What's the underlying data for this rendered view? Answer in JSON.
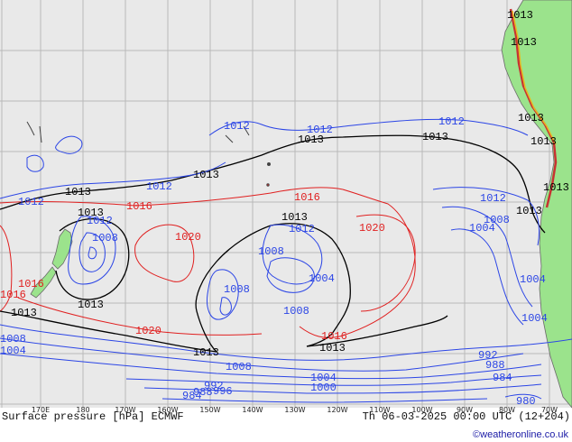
{
  "colors": {
    "ocean": "#e9e9e9",
    "land": "#9be38c",
    "grid": "#b9b9b9",
    "isobar_low": "#2b45e6",
    "isobar_mid": "#000000",
    "isobar_high": "#e02020",
    "credit": "#1a1aa6"
  },
  "footer": {
    "left": "Surface pressure [hPa] ECMWF",
    "right": "Th 06-03-2025 00:00 UTC (12+204)",
    "credit": "©weatheronline.co.uk"
  },
  "longitude_labels": [
    "170E",
    "180",
    "170W",
    "160W",
    "150W",
    "140W",
    "130W",
    "120W",
    "110W",
    "100W",
    "90W",
    "80W",
    "70W"
  ],
  "isobar_labels": [
    {
      "text": "1013",
      "color": "black"
    },
    {
      "text": "1013",
      "color": "black"
    },
    {
      "text": "1013",
      "color": "black"
    },
    {
      "text": "1013",
      "color": "black"
    },
    {
      "text": "1013",
      "color": "black"
    },
    {
      "text": "1013",
      "color": "black"
    },
    {
      "text": "1013",
      "color": "black"
    },
    {
      "text": "1013",
      "color": "black"
    },
    {
      "text": "1013",
      "color": "black"
    },
    {
      "text": "1013",
      "color": "black"
    },
    {
      "text": "1013",
      "color": "black"
    },
    {
      "text": "1013",
      "color": "black"
    },
    {
      "text": "1013",
      "color": "black"
    },
    {
      "text": "1013",
      "color": "black"
    },
    {
      "text": "1013",
      "color": "black"
    },
    {
      "text": "1012",
      "color": "blue"
    },
    {
      "text": "1012",
      "color": "blue"
    },
    {
      "text": "1012",
      "color": "blue"
    },
    {
      "text": "1012",
      "color": "blue"
    },
    {
      "text": "1012",
      "color": "blue"
    },
    {
      "text": "1012",
      "color": "blue"
    },
    {
      "text": "1012",
      "color": "blue"
    },
    {
      "text": "1012",
      "color": "blue"
    },
    {
      "text": "1008",
      "color": "blue"
    },
    {
      "text": "1008",
      "color": "blue"
    },
    {
      "text": "1008",
      "color": "blue"
    },
    {
      "text": "1008",
      "color": "blue"
    },
    {
      "text": "1008",
      "color": "blue"
    },
    {
      "text": "1008",
      "color": "blue"
    },
    {
      "text": "1008",
      "color": "blue"
    },
    {
      "text": "1004",
      "color": "blue"
    },
    {
      "text": "1004",
      "color": "blue"
    },
    {
      "text": "1004",
      "color": "blue"
    },
    {
      "text": "1004",
      "color": "blue"
    },
    {
      "text": "1004",
      "color": "blue"
    },
    {
      "text": "1004",
      "color": "blue"
    },
    {
      "text": "1000",
      "color": "blue"
    },
    {
      "text": "996",
      "color": "blue"
    },
    {
      "text": "992",
      "color": "blue"
    },
    {
      "text": "992",
      "color": "blue"
    },
    {
      "text": "988",
      "color": "blue"
    },
    {
      "text": "988",
      "color": "blue"
    },
    {
      "text": "984",
      "color": "blue"
    },
    {
      "text": "984",
      "color": "blue"
    },
    {
      "text": "980",
      "color": "blue"
    },
    {
      "text": "1016",
      "color": "red"
    },
    {
      "text": "1016",
      "color": "red"
    },
    {
      "text": "1016",
      "color": "red"
    },
    {
      "text": "1016",
      "color": "red"
    },
    {
      "text": "1016",
      "color": "red"
    },
    {
      "text": "1020",
      "color": "red"
    },
    {
      "text": "1020",
      "color": "red"
    },
    {
      "text": "1020",
      "color": "red"
    }
  ]
}
